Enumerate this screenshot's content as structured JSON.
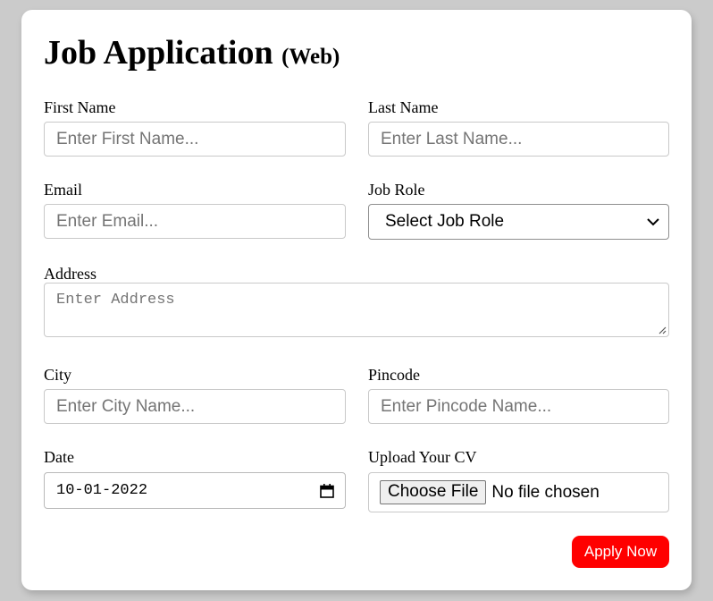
{
  "form": {
    "title": "Job Application",
    "subtitle": "(Web)",
    "fields": {
      "first_name": {
        "label": "First Name",
        "placeholder": "Enter First Name..."
      },
      "last_name": {
        "label": "Last Name",
        "placeholder": "Enter Last Name..."
      },
      "email": {
        "label": "Email",
        "placeholder": "Enter Email..."
      },
      "job_role": {
        "label": "Job Role",
        "selected": "Select Job Role"
      },
      "address": {
        "label": "Address",
        "placeholder": "Enter Address"
      },
      "city": {
        "label": "City",
        "placeholder": "Enter City Name..."
      },
      "pincode": {
        "label": "Pincode",
        "placeholder": "Enter Pincode Name..."
      },
      "date": {
        "label": "Date",
        "value": "10-01-2022"
      },
      "cv": {
        "label": "Upload Your CV",
        "button": "Choose File",
        "status": "No file chosen"
      }
    },
    "submit_label": "Apply Now"
  },
  "colors": {
    "page_background": "#cbcbcb",
    "card_background": "#ffffff",
    "accent": "#ff0000"
  },
  "icons": {
    "select_arrow": "chevron-down-icon",
    "date_picker": "calendar-icon",
    "textarea_resize": "resize-handle-icon"
  }
}
